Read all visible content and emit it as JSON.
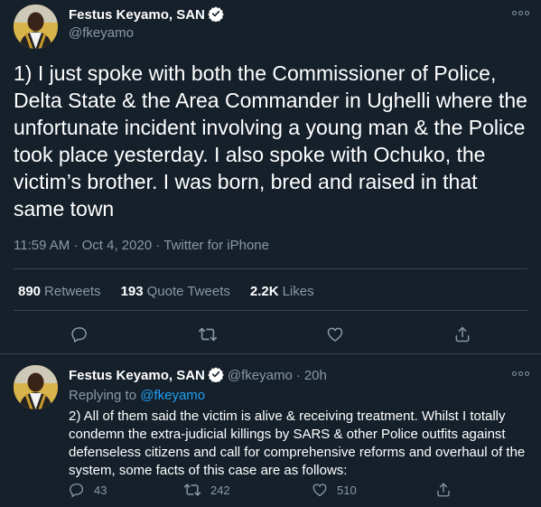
{
  "main_tweet": {
    "author_name": "Festus Keyamo, SAN",
    "handle": "@fkeyamo",
    "text": "1) I just spoke with both the Commissioner of Police, Delta State & the Area Commander in Ughelli where the unfortunate incident involving a young man & the Police took place yesterday. I also spoke with Ochuko, the victim’s brother. I was born, bred and raised in that same town",
    "time": "11:59 AM",
    "date": "Oct 4, 2020",
    "source": "Twitter for iPhone",
    "separator": "·",
    "retweets_count": "890",
    "retweets_label": "Retweets",
    "quotes_count": "193",
    "quotes_label": "Quote Tweets",
    "likes_count": "2.2K",
    "likes_label": "Likes"
  },
  "reply_tweet": {
    "author_name": "Festus Keyamo, SAN",
    "handle": "@fkeyamo",
    "separator": "·",
    "age": "20h",
    "replying_prefix": "Replying to",
    "replying_to": "@fkeyamo",
    "text": "2) All of them said the victim is alive & receiving treatment. Whilst I totally condemn the extra-judicial killings by SARS & other Police outfits against defenseless citizens and call for comprehensive reforms and overhaul of the system, some facts of this case are as follows:",
    "reply_count": "43",
    "retweet_count": "242",
    "like_count": "510"
  },
  "icons": [
    "verified-badge-icon",
    "more-icon",
    "reply-icon",
    "retweet-icon",
    "like-icon",
    "share-icon"
  ],
  "colors": {
    "background": "#15202b",
    "muted": "#8899a6",
    "accent": "#1da1f2",
    "divider": "#38444d"
  }
}
